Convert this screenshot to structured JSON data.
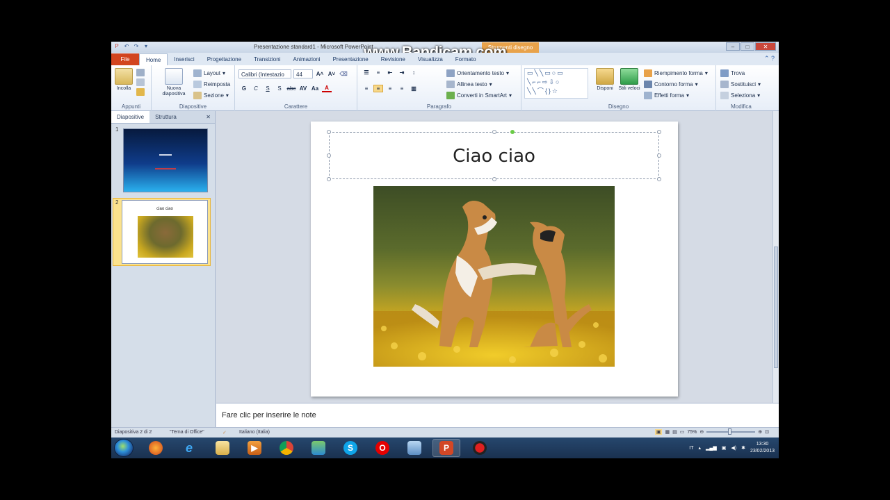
{
  "app": {
    "window_title": "Presentazione standard1 - Microsoft PowerPoint",
    "contextual_tab": "Strumenti disegno",
    "watermark": "www.Bandicam.com"
  },
  "ribbon_tabs": [
    "File",
    "Home",
    "Inserisci",
    "Progettazione",
    "Transizioni",
    "Animazioni",
    "Presentazione",
    "Revisione",
    "Visualizza",
    "Formato"
  ],
  "ribbon": {
    "groups": {
      "clipboard": "Appunti",
      "slides": "Diapositive",
      "font": "Carattere",
      "paragraph": "Paragrafo",
      "drawing": "Disegno",
      "editing": "Modifica"
    },
    "paste": "Incolla",
    "new_slide": "Nuova diapositiva",
    "layout": "Layout",
    "reset": "Reimposta",
    "section": "Sezione",
    "font_name": "Calibri (Intestazio",
    "font_size": "44",
    "bold": "G",
    "italic": "C",
    "underline": "S",
    "strike": "S",
    "text_direction": "Orientamento testo",
    "align_text": "Allinea testo",
    "smartart": "Converti in SmartArt",
    "arrange": "Disponi",
    "quick_styles": "Stili veloci",
    "shape_fill": "Riempimento forma",
    "shape_outline": "Contorno forma",
    "shape_effects": "Effetti forma",
    "find": "Trova",
    "replace": "Sostituisci",
    "select": "Seleziona"
  },
  "left_pane": {
    "tabs": [
      "Diapositive",
      "Struttura"
    ],
    "close": "✕",
    "slides": [
      {
        "number": "1"
      },
      {
        "number": "2",
        "title": "ciao ciao"
      }
    ]
  },
  "slide": {
    "title": "Ciao ciao"
  },
  "notes": {
    "placeholder": "Fare clic per inserire le note"
  },
  "status": {
    "slide_counter": "Diapositiva 2 di 2",
    "theme": "\"Tema di Office\"",
    "language": "Italiano (Italia)",
    "zoom": "75%"
  },
  "taskbar": {
    "tray_lang": "IT",
    "time": "13:30",
    "date": "23/02/2013"
  }
}
